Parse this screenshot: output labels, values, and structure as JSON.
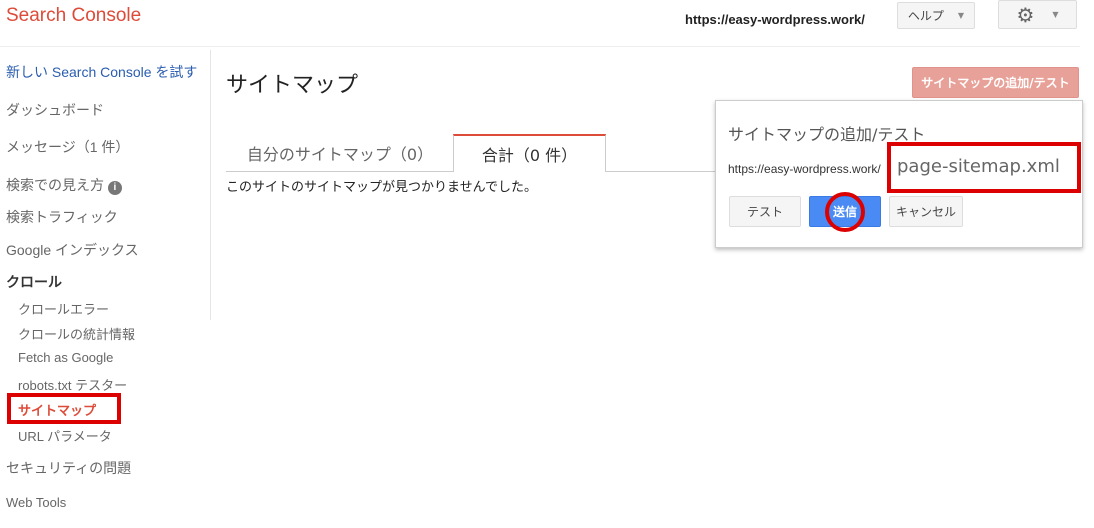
{
  "header": {
    "logo": "Search Console",
    "site": "https://easy-wordpress.work/",
    "help": "ヘルプ"
  },
  "sidebar": {
    "items": [
      {
        "label": "新しい Search Console を試す"
      },
      {
        "label": "ダッシュボード"
      },
      {
        "label": "メッセージ（1 件）"
      },
      {
        "label": "検索での見え方"
      },
      {
        "label": "検索トラフィック"
      },
      {
        "label": "Google インデックス"
      },
      {
        "label": "クロール"
      },
      {
        "label": "クロールエラー"
      },
      {
        "label": "クロールの統計情報"
      },
      {
        "label": "Fetch as Google"
      },
      {
        "label": "robots.txt テスター"
      },
      {
        "label": "サイトマップ"
      },
      {
        "label": "URL パラメータ"
      },
      {
        "label": "セキュリティの問題"
      },
      {
        "label": "Web Tools"
      }
    ]
  },
  "main": {
    "title": "サイトマップ",
    "add_button": "サイトマップの追加/テスト",
    "tabs": [
      {
        "label": "自分のサイトマップ（0）"
      },
      {
        "label": "合計（0 件）"
      }
    ],
    "empty": "このサイトのサイトマップが見つかりませんでした。"
  },
  "popup": {
    "title": "サイトマップの追加/テスト",
    "prefix": "https://easy-wordpress.work/",
    "input": "page-sitemap.xml",
    "test": "テスト",
    "submit": "送信",
    "cancel": "キャンセル"
  }
}
